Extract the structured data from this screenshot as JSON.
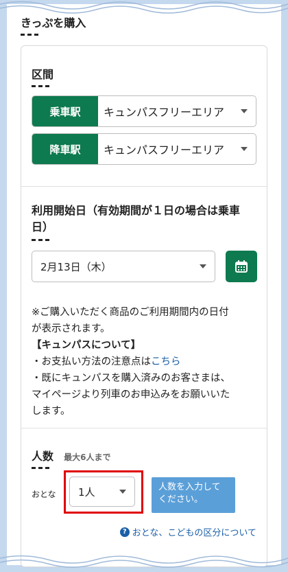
{
  "header": {
    "title": "きっぷを購入"
  },
  "route": {
    "title": "区間",
    "boarding": {
      "tag": "乗車駅",
      "value": "キュンパスフリーエリア"
    },
    "alighting": {
      "tag": "降車駅",
      "value": "キュンパスフリーエリア"
    }
  },
  "start_date": {
    "title_line1": "利用開始日（有効期間が１日の場合は乗車",
    "title_line2": "日）",
    "selected": "2月13日（木）"
  },
  "note": {
    "line1": "※ご購入いただく商品のご利用期間内の日付",
    "line2": "が表示されます。",
    "heading": "【キュンパスについて】",
    "line3_prefix": "・お支払い方法の注意点は",
    "line3_link": "こちら",
    "line4": "・既にキュンパスを購入済みのお客さまは、",
    "line5": "マイページより列車のお申込みをお願いいた",
    "line6": "します。"
  },
  "persons": {
    "title": "人数",
    "max_note": "最大6人まで",
    "adult_label": "おとな",
    "adult_count": "1人",
    "submit_line1": "人数を入力して",
    "submit_line2": "ください。",
    "help_link": "おとな、こどもの区分について"
  },
  "colors": {
    "accent_green": "#0e7a4f",
    "frame_blue": "#c4d8ee",
    "button_blue": "#5b9fd8",
    "highlight_red": "#e00000"
  }
}
